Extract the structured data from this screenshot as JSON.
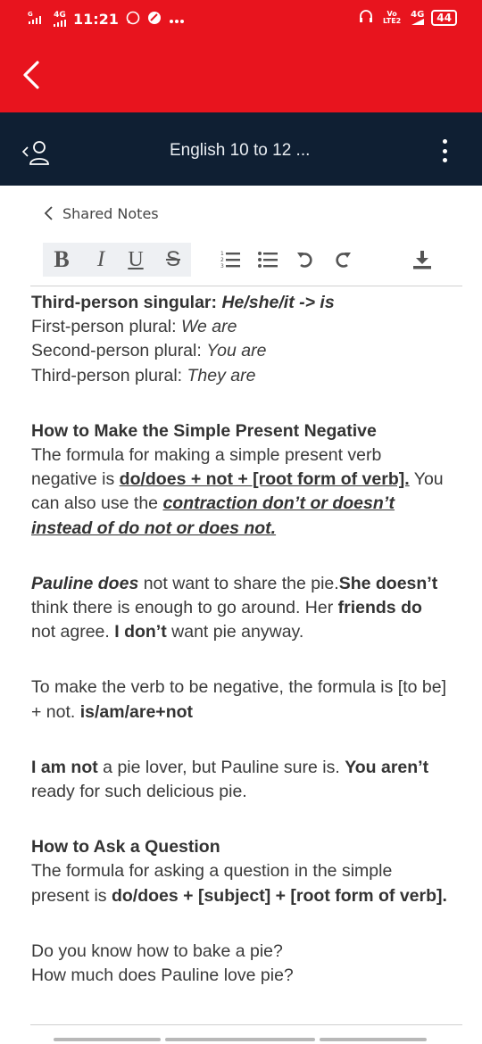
{
  "status_bar": {
    "carrier_small": "G",
    "network_left": "4G",
    "time": "11:21",
    "volte": "Vo LTE2",
    "network_right": "4G",
    "battery": "44"
  },
  "app_bar": {
    "back_icon": "chevron-left-icon"
  },
  "course_bar": {
    "title": "English 10 to 12 ..."
  },
  "shared_nav": {
    "label": "Shared Notes"
  },
  "toolbar": {
    "bold": "B",
    "italic": "I",
    "underline": "U",
    "strike": "S",
    "icons": [
      "ordered-list-icon",
      "bullet-list-icon",
      "undo-icon",
      "redo-icon",
      "download-icon"
    ]
  },
  "note": {
    "line1_bold": "Third-person singular: ",
    "line1_bold_italic": "He/she/it -> is",
    "line2_text": "First-person plural: ",
    "line2_italic": "We are",
    "line3_text": "Second-person plural: ",
    "line3_italic": "You are",
    "line4_text": "Third-person plural: ",
    "line4_italic": "They are",
    "heading_negative": "How to Make the Simple Present Negative",
    "neg_text1": "The formula for making a simple present verb negative is ",
    "neg_formula": "do/does + not + [root form of verb].",
    "neg_text2": " You can also use the ",
    "neg_contraction": "contraction don’t or doesn’t instead of do not or does not.",
    "pauline_bold_italic": "Pauline does",
    "pauline_t1": " not want to share the pie.",
    "pauline_b1": "She doesn’t",
    "pauline_t2": " think there is enough to go around. Her ",
    "pauline_b2": "friends do",
    "pauline_t3": " not agree. ",
    "pauline_b3": "I don’t",
    "pauline_t4": " want pie anyway.",
    "tobe_text": "To make the verb to be negative, the formula is [to be] + not. ",
    "tobe_bold": "is/am/are+not",
    "iam_b1": "I am not",
    "iam_t1": " a pie lover, but Pauline sure is. ",
    "iam_b2": "You aren’t",
    "iam_t2": " ready for such delicious pie.",
    "heading_question": "How to Ask a Question",
    "q_text": "The formula for asking a question in the simple present is ",
    "q_formula": "do/does + [subject] + [root form of verb].",
    "ex1": "Do you know how to bake a pie?",
    "ex2": "How much does Pauline love pie?"
  },
  "colors": {
    "app_bar_red": "#e8141e",
    "course_bar_navy": "#0f1f33",
    "toolbar_bg": "#eef0f3"
  }
}
